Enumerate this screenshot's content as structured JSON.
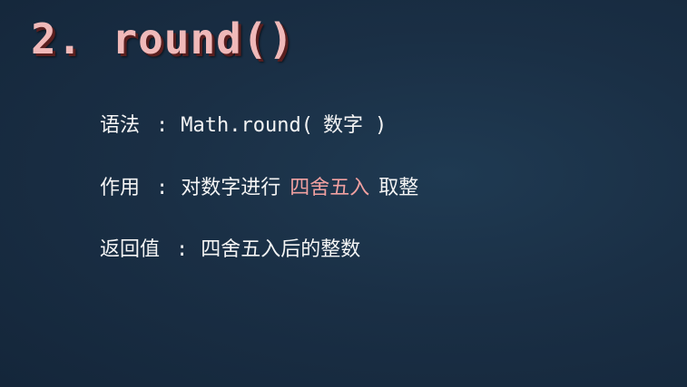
{
  "title": {
    "number": "2.",
    "func": "round()"
  },
  "rows": [
    {
      "label": "语法",
      "colon": ":",
      "syntax_code": "Math.round(",
      "syntax_arg": "数字",
      "syntax_close": ")"
    },
    {
      "label": "作用",
      "colon": ":",
      "text_before": "对数字进行",
      "highlight": "四舍五入",
      "text_after": "取整",
      "highlight_color": "#f0a0a0"
    },
    {
      "label": "返回值",
      "colon": ":",
      "text": "四舍五入后的整数"
    }
  ]
}
